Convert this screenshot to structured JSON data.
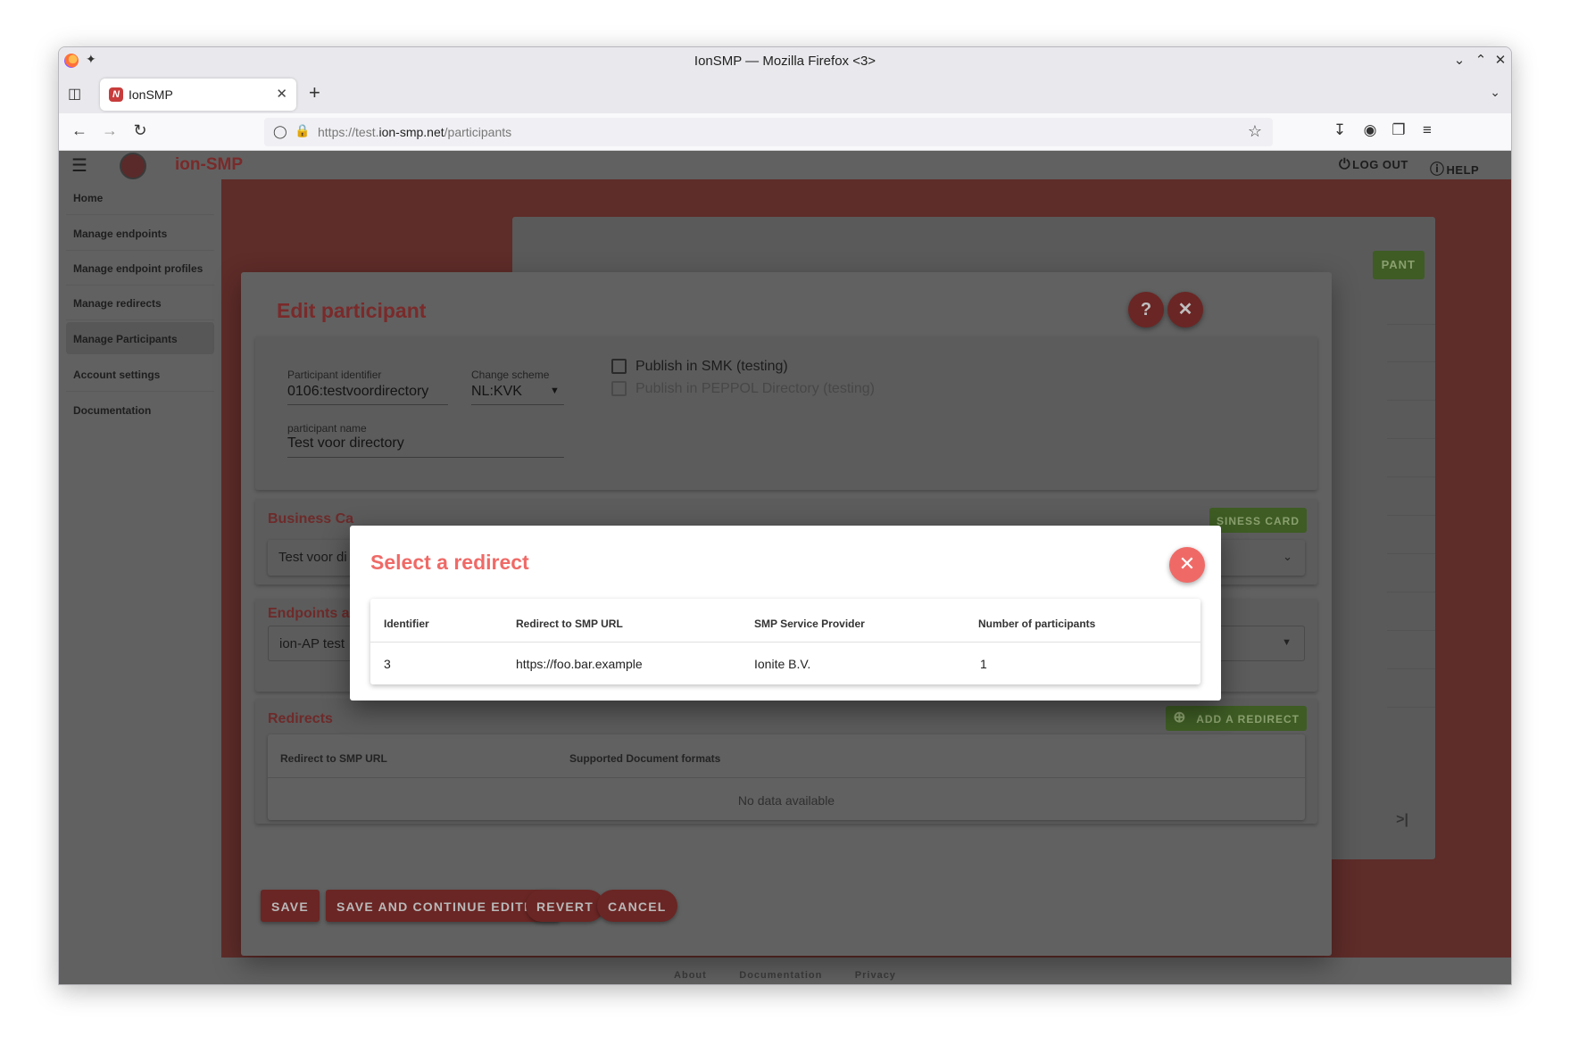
{
  "browser": {
    "window_title": "IonSMP — Mozilla Firefox <3>",
    "tab_title": "IonSMP",
    "url_prefix": "https://test.",
    "url_domain": "ion-smp.net",
    "url_path": "/participants"
  },
  "app": {
    "brand": "ion-SMP",
    "logout_label": "LOG OUT",
    "help_label": "HELP"
  },
  "sidebar": {
    "items": [
      {
        "label": "Home"
      },
      {
        "label": "Manage endpoints"
      },
      {
        "label": "Manage endpoint profiles"
      },
      {
        "label": "Manage redirects"
      },
      {
        "label": "Manage Participants"
      },
      {
        "label": "Account settings"
      },
      {
        "label": "Documentation"
      }
    ]
  },
  "background": {
    "add_button": "PANT"
  },
  "edit": {
    "title": "Edit participant",
    "participant_identifier_label": "Participant identifier",
    "participant_identifier_value": "0106:testvoordirectory",
    "change_scheme_label": "Change scheme",
    "change_scheme_value": "NL:KVK",
    "participant_name_label": "participant name",
    "participant_name_value": "Test voor directory",
    "publish_smk": "Publish in SMK (testing)",
    "publish_peppol": "Publish in PEPPOL Directory (testing)",
    "business_card_title": "Business Ca",
    "business_card_button": "SINESS CARD",
    "business_card_value": "Test voor di",
    "endpoints_title": "Endpoints a",
    "endpoints_value": "ion-AP test",
    "redirects_title": "Redirects",
    "add_redirect_button": "ADD A REDIRECT",
    "redirects_table": {
      "headers": [
        "Redirect to SMP URL",
        "Supported Document formats"
      ],
      "empty": "No data available"
    },
    "buttons": {
      "save": "SAVE",
      "save_continue": "SAVE AND CONTINUE EDITING",
      "revert": "REVERT",
      "cancel": "CANCEL"
    }
  },
  "select_redirect": {
    "title": "Select a redirect",
    "headers": [
      "Identifier",
      "Redirect to SMP URL",
      "SMP Service Provider",
      "Number of participants"
    ],
    "rows": [
      {
        "identifier": "3",
        "url": "https://foo.bar.example",
        "provider": "Ionite B.V.",
        "participants": "1"
      }
    ]
  },
  "footer": {
    "links": [
      "About",
      "Documentation",
      "Privacy"
    ]
  },
  "colors": {
    "accent_red": "#ef6a67",
    "dim_overlay": "#616161",
    "green_button": "#3e5c24"
  }
}
